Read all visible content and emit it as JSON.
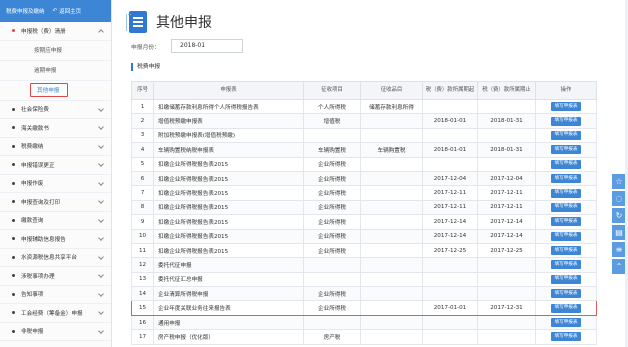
{
  "sidebar": {
    "top_left": "税费申报及缴纳",
    "back_label": "返回主页",
    "items": [
      {
        "label": "申报税（费）清册",
        "open": true
      },
      {
        "label": "按期应申报",
        "sub": true
      },
      {
        "label": "逾期申报",
        "sub": true
      },
      {
        "label": "其他申报",
        "sub": true,
        "active": true
      },
      {
        "label": "社会保险费"
      },
      {
        "label": "海关缴款书"
      },
      {
        "label": "税费缴纳"
      },
      {
        "label": "申报错误更正"
      },
      {
        "label": "申报作废"
      },
      {
        "label": "申报查询及打印"
      },
      {
        "label": "缴款查询"
      },
      {
        "label": "申报辅助信息报告"
      },
      {
        "label": "水资源税信息共享平台"
      },
      {
        "label": "涉税事项办理"
      },
      {
        "label": "告知事项"
      },
      {
        "label": "工会经费（筹备金）申报"
      },
      {
        "label": "非税申报"
      }
    ]
  },
  "header": {
    "title": "其他申报",
    "month_label": "申报月份：",
    "month_value": "2018-01",
    "section_title": "税费申报"
  },
  "table": {
    "columns": [
      "序号",
      "申报表",
      "征收项目",
      "征收品目",
      "税（费）款所属期起",
      "税（费）款所属期止",
      "操作"
    ],
    "button_label": "填写申报表",
    "rows": [
      {
        "no": "1",
        "form": "扣缴储蓄存款利息所得个人所得税报告表",
        "item": "个人所得税",
        "sub": "储蓄存款利息所得",
        "start": "",
        "end": ""
      },
      {
        "no": "2",
        "form": "增值税预缴申报表",
        "item": "增值税",
        "sub": "",
        "start": "2018-01-01",
        "end": "2018-01-31"
      },
      {
        "no": "3",
        "form": "附加税预缴申报表(增值税预缴)",
        "item": "",
        "sub": "",
        "start": "",
        "end": ""
      },
      {
        "no": "4",
        "form": "车辆购置税纳税申报表",
        "item": "车辆购置税",
        "sub": "车辆购置税",
        "start": "2018-01-01",
        "end": "2018-01-31"
      },
      {
        "no": "5",
        "form": "扣缴企业所得税报告表2015",
        "item": "企业所得税",
        "sub": "",
        "start": "",
        "end": ""
      },
      {
        "no": "6",
        "form": "扣缴企业所得税报告表2015",
        "item": "企业所得税",
        "sub": "",
        "start": "2017-12-04",
        "end": "2017-12-04"
      },
      {
        "no": "7",
        "form": "扣缴企业所得税报告表2015",
        "item": "企业所得税",
        "sub": "",
        "start": "2017-12-11",
        "end": "2017-12-11"
      },
      {
        "no": "8",
        "form": "扣缴企业所得税报告表2015",
        "item": "企业所得税",
        "sub": "",
        "start": "2017-12-11",
        "end": "2017-12-11"
      },
      {
        "no": "9",
        "form": "扣缴企业所得税报告表2015",
        "item": "企业所得税",
        "sub": "",
        "start": "2017-12-14",
        "end": "2017-12-14"
      },
      {
        "no": "10",
        "form": "扣缴企业所得税报告表2015",
        "item": "企业所得税",
        "sub": "",
        "start": "2017-12-14",
        "end": "2017-12-14"
      },
      {
        "no": "11",
        "form": "扣缴企业所得税报告表2015",
        "item": "企业所得税",
        "sub": "",
        "start": "2017-12-25",
        "end": "2017-12-25"
      },
      {
        "no": "12",
        "form": "委托代征申报",
        "item": "",
        "sub": "",
        "start": "",
        "end": ""
      },
      {
        "no": "13",
        "form": "委托代征汇总申报",
        "item": "",
        "sub": "",
        "start": "",
        "end": ""
      },
      {
        "no": "14",
        "form": "企业清算所得税申报",
        "item": "企业所得税",
        "sub": "",
        "start": "",
        "end": ""
      },
      {
        "no": "15",
        "form": "企业年度关联业务往来报告表",
        "item": "企业所得税",
        "sub": "",
        "start": "2017-01-01",
        "end": "2017-12-31",
        "highlight": true
      },
      {
        "no": "16",
        "form": "通用申报",
        "item": "",
        "sub": "",
        "start": "",
        "end": ""
      },
      {
        "no": "17",
        "form": "房产税申报（优化版）",
        "item": "房产税",
        "sub": "",
        "start": "",
        "end": ""
      }
    ]
  },
  "rail": [
    "star-icon",
    "comment-icon",
    "refresh-icon",
    "document-icon",
    "list-icon",
    "up-icon"
  ]
}
